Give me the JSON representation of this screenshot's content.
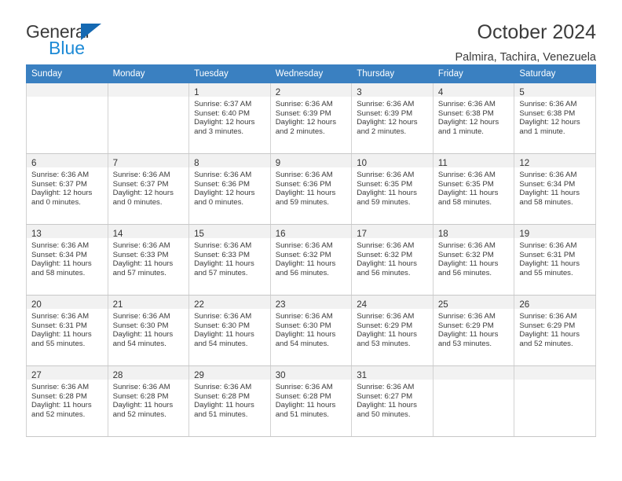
{
  "brand": {
    "line1": "General",
    "line2": "Blue",
    "triangle_icon": "blue-triangle-logo-mark",
    "color_dark": "#3b3b3b",
    "color_blue": "#1d8ad6",
    "color_triangle": "#1569b2"
  },
  "header": {
    "month_title": "October 2024",
    "location": "Palmira, Tachira, Venezuela"
  },
  "colors": {
    "header_row_bg": "#3a80c1",
    "header_row_text": "#ffffff",
    "daynum_band_bg": "#f1f1f1",
    "blank_cell_bg": "#f2f2f2",
    "cell_border": "#d2d2d2",
    "body_text": "#3a3a3a"
  },
  "labels": {
    "sunrise_prefix": "Sunrise:",
    "sunset_prefix": "Sunset:",
    "daylight_prefix": "Daylight:"
  },
  "columns": [
    "Sunday",
    "Monday",
    "Tuesday",
    "Wednesday",
    "Thursday",
    "Friday",
    "Saturday"
  ],
  "weeks": [
    [
      null,
      null,
      {
        "day": "1",
        "sunrise": "Sunrise: 6:37 AM",
        "sunset": "Sunset: 6:40 PM",
        "daylight": "Daylight: 12 hours and 3 minutes."
      },
      {
        "day": "2",
        "sunrise": "Sunrise: 6:36 AM",
        "sunset": "Sunset: 6:39 PM",
        "daylight": "Daylight: 12 hours and 2 minutes."
      },
      {
        "day": "3",
        "sunrise": "Sunrise: 6:36 AM",
        "sunset": "Sunset: 6:39 PM",
        "daylight": "Daylight: 12 hours and 2 minutes."
      },
      {
        "day": "4",
        "sunrise": "Sunrise: 6:36 AM",
        "sunset": "Sunset: 6:38 PM",
        "daylight": "Daylight: 12 hours and 1 minute."
      },
      {
        "day": "5",
        "sunrise": "Sunrise: 6:36 AM",
        "sunset": "Sunset: 6:38 PM",
        "daylight": "Daylight: 12 hours and 1 minute."
      }
    ],
    [
      {
        "day": "6",
        "sunrise": "Sunrise: 6:36 AM",
        "sunset": "Sunset: 6:37 PM",
        "daylight": "Daylight: 12 hours and 0 minutes."
      },
      {
        "day": "7",
        "sunrise": "Sunrise: 6:36 AM",
        "sunset": "Sunset: 6:37 PM",
        "daylight": "Daylight: 12 hours and 0 minutes."
      },
      {
        "day": "8",
        "sunrise": "Sunrise: 6:36 AM",
        "sunset": "Sunset: 6:36 PM",
        "daylight": "Daylight: 12 hours and 0 minutes."
      },
      {
        "day": "9",
        "sunrise": "Sunrise: 6:36 AM",
        "sunset": "Sunset: 6:36 PM",
        "daylight": "Daylight: 11 hours and 59 minutes."
      },
      {
        "day": "10",
        "sunrise": "Sunrise: 6:36 AM",
        "sunset": "Sunset: 6:35 PM",
        "daylight": "Daylight: 11 hours and 59 minutes."
      },
      {
        "day": "11",
        "sunrise": "Sunrise: 6:36 AM",
        "sunset": "Sunset: 6:35 PM",
        "daylight": "Daylight: 11 hours and 58 minutes."
      },
      {
        "day": "12",
        "sunrise": "Sunrise: 6:36 AM",
        "sunset": "Sunset: 6:34 PM",
        "daylight": "Daylight: 11 hours and 58 minutes."
      }
    ],
    [
      {
        "day": "13",
        "sunrise": "Sunrise: 6:36 AM",
        "sunset": "Sunset: 6:34 PM",
        "daylight": "Daylight: 11 hours and 58 minutes."
      },
      {
        "day": "14",
        "sunrise": "Sunrise: 6:36 AM",
        "sunset": "Sunset: 6:33 PM",
        "daylight": "Daylight: 11 hours and 57 minutes."
      },
      {
        "day": "15",
        "sunrise": "Sunrise: 6:36 AM",
        "sunset": "Sunset: 6:33 PM",
        "daylight": "Daylight: 11 hours and 57 minutes."
      },
      {
        "day": "16",
        "sunrise": "Sunrise: 6:36 AM",
        "sunset": "Sunset: 6:32 PM",
        "daylight": "Daylight: 11 hours and 56 minutes."
      },
      {
        "day": "17",
        "sunrise": "Sunrise: 6:36 AM",
        "sunset": "Sunset: 6:32 PM",
        "daylight": "Daylight: 11 hours and 56 minutes."
      },
      {
        "day": "18",
        "sunrise": "Sunrise: 6:36 AM",
        "sunset": "Sunset: 6:32 PM",
        "daylight": "Daylight: 11 hours and 56 minutes."
      },
      {
        "day": "19",
        "sunrise": "Sunrise: 6:36 AM",
        "sunset": "Sunset: 6:31 PM",
        "daylight": "Daylight: 11 hours and 55 minutes."
      }
    ],
    [
      {
        "day": "20",
        "sunrise": "Sunrise: 6:36 AM",
        "sunset": "Sunset: 6:31 PM",
        "daylight": "Daylight: 11 hours and 55 minutes."
      },
      {
        "day": "21",
        "sunrise": "Sunrise: 6:36 AM",
        "sunset": "Sunset: 6:30 PM",
        "daylight": "Daylight: 11 hours and 54 minutes."
      },
      {
        "day": "22",
        "sunrise": "Sunrise: 6:36 AM",
        "sunset": "Sunset: 6:30 PM",
        "daylight": "Daylight: 11 hours and 54 minutes."
      },
      {
        "day": "23",
        "sunrise": "Sunrise: 6:36 AM",
        "sunset": "Sunset: 6:30 PM",
        "daylight": "Daylight: 11 hours and 54 minutes."
      },
      {
        "day": "24",
        "sunrise": "Sunrise: 6:36 AM",
        "sunset": "Sunset: 6:29 PM",
        "daylight": "Daylight: 11 hours and 53 minutes."
      },
      {
        "day": "25",
        "sunrise": "Sunrise: 6:36 AM",
        "sunset": "Sunset: 6:29 PM",
        "daylight": "Daylight: 11 hours and 53 minutes."
      },
      {
        "day": "26",
        "sunrise": "Sunrise: 6:36 AM",
        "sunset": "Sunset: 6:29 PM",
        "daylight": "Daylight: 11 hours and 52 minutes."
      }
    ],
    [
      {
        "day": "27",
        "sunrise": "Sunrise: 6:36 AM",
        "sunset": "Sunset: 6:28 PM",
        "daylight": "Daylight: 11 hours and 52 minutes."
      },
      {
        "day": "28",
        "sunrise": "Sunrise: 6:36 AM",
        "sunset": "Sunset: 6:28 PM",
        "daylight": "Daylight: 11 hours and 52 minutes."
      },
      {
        "day": "29",
        "sunrise": "Sunrise: 6:36 AM",
        "sunset": "Sunset: 6:28 PM",
        "daylight": "Daylight: 11 hours and 51 minutes."
      },
      {
        "day": "30",
        "sunrise": "Sunrise: 6:36 AM",
        "sunset": "Sunset: 6:28 PM",
        "daylight": "Daylight: 11 hours and 51 minutes."
      },
      {
        "day": "31",
        "sunrise": "Sunrise: 6:36 AM",
        "sunset": "Sunset: 6:27 PM",
        "daylight": "Daylight: 11 hours and 50 minutes."
      },
      null,
      null
    ]
  ]
}
